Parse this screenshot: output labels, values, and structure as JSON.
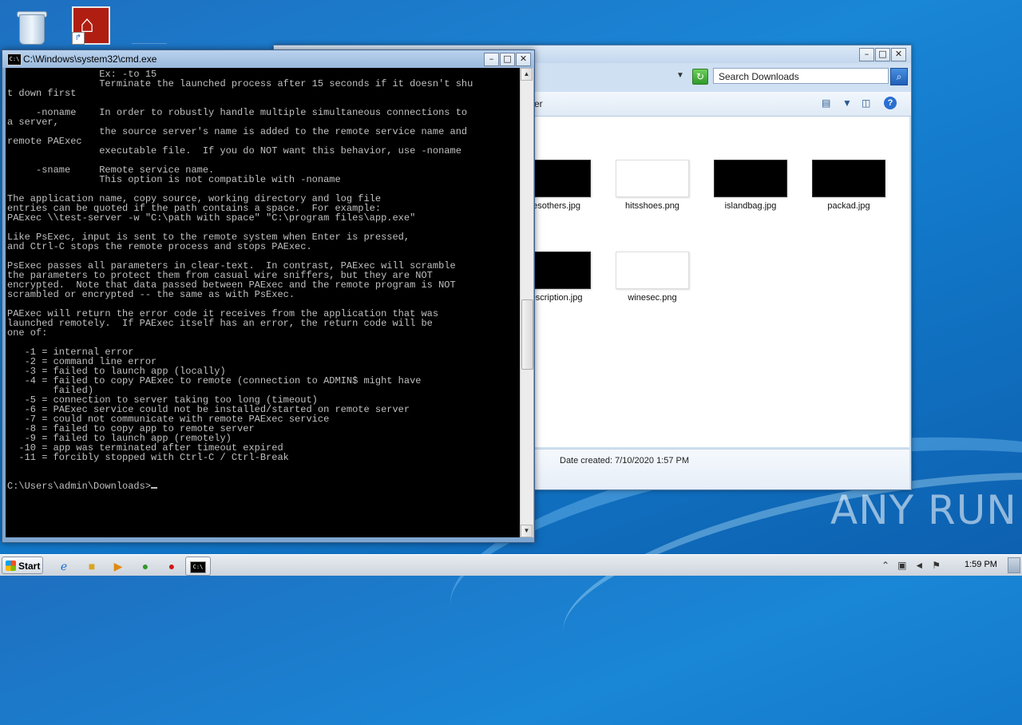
{
  "desktop": {
    "icons": [
      {
        "name": "Recycle Bin"
      },
      {
        "name": "Acrobat Reader DC"
      }
    ]
  },
  "explorer": {
    "search_placeholder": "Search Downloads",
    "command_bar_text": "er",
    "files": [
      {
        "name": "desothers.jpg",
        "thumb_color": "#000000"
      },
      {
        "name": "hitsshoes.png",
        "thumb_color": "#ffffff"
      },
      {
        "name": "islandbag.jpg",
        "thumb_color": "#000000"
      },
      {
        "name": "packad.jpg",
        "thumb_color": "#000000"
      },
      {
        "name": "description.jpg",
        "thumb_color": "#000000"
      },
      {
        "name": "winesec.png",
        "thumb_color": "#ffffff"
      }
    ],
    "details": "Date created: 7/10/2020 1:57 PM"
  },
  "cmd": {
    "title": "C:\\Windows\\system32\\cmd.exe",
    "output": "                Ex: -to 15\n                Terminate the launched process after 15 seconds if it doesn't shu\nt down first\n\n     -noname    In order to robustly handle multiple simultaneous connections to\na server,\n                the source server's name is added to the remote service name and\nremote PAExec\n                executable file.  If you do NOT want this behavior, use -noname\n\n     -sname     Remote service name.\n                This option is not compatible with -noname\n\nThe application name, copy source, working directory and log file\nentries can be quoted if the path contains a space.  For example:\nPAExec \\\\test-server -w \"C:\\path with space\" \"C:\\program files\\app.exe\"\n\nLike PsExec, input is sent to the remote system when Enter is pressed,\nand Ctrl-C stops the remote process and stops PAExec.\n\nPsExec passes all parameters in clear-text.  In contrast, PAExec will scramble\nthe parameters to protect them from casual wire sniffers, but they are NOT\nencrypted.  Note that data passed between PAExec and the remote program is NOT\nscrambled or encrypted -- the same as with PsExec.\n\nPAExec will return the error code it receives from the application that was\nlaunched remotely.  If PAExec itself has an error, the return code will be\none of:\n\n   -1 = internal error\n   -2 = command line error\n   -3 = failed to launch app (locally)\n   -4 = failed to copy PAExec to remote (connection to ADMIN$ might have\n        failed)\n   -5 = connection to server taking too long (timeout)\n   -6 = PAExec service could not be installed/started on remote server\n   -7 = could not communicate with remote PAExec service\n   -8 = failed to copy app to remote server\n   -9 = failed to launch app (remotely)\n  -10 = app was terminated after timeout expired\n  -11 = forcibly stopped with Ctrl-C / Ctrl-Break\n\n\n",
    "prompt": "C:\\Users\\admin\\Downloads>"
  },
  "watermark": "ANY RUN",
  "taskbar": {
    "start_label": "Start",
    "clock": "1:59 PM",
    "pinned": [
      {
        "name": "Internet Explorer",
        "icon": "ie-icon"
      },
      {
        "name": "Windows Explorer",
        "icon": "folder-icon"
      },
      {
        "name": "Windows Media Player",
        "icon": "media-player-icon"
      },
      {
        "name": "Google Chrome",
        "icon": "chrome-icon"
      },
      {
        "name": "Opera",
        "icon": "opera-icon"
      },
      {
        "name": "Command Prompt",
        "icon": "cmd-icon"
      }
    ],
    "tray_icons": [
      "chevron-up-icon",
      "network-icon",
      "volume-icon",
      "flag-icon"
    ]
  },
  "colors": {
    "console_bg": "#000000",
    "console_fg": "#c0c0c0",
    "desktop_bg": "#1a86d6",
    "taskbar_bg": "#d9dee5"
  }
}
